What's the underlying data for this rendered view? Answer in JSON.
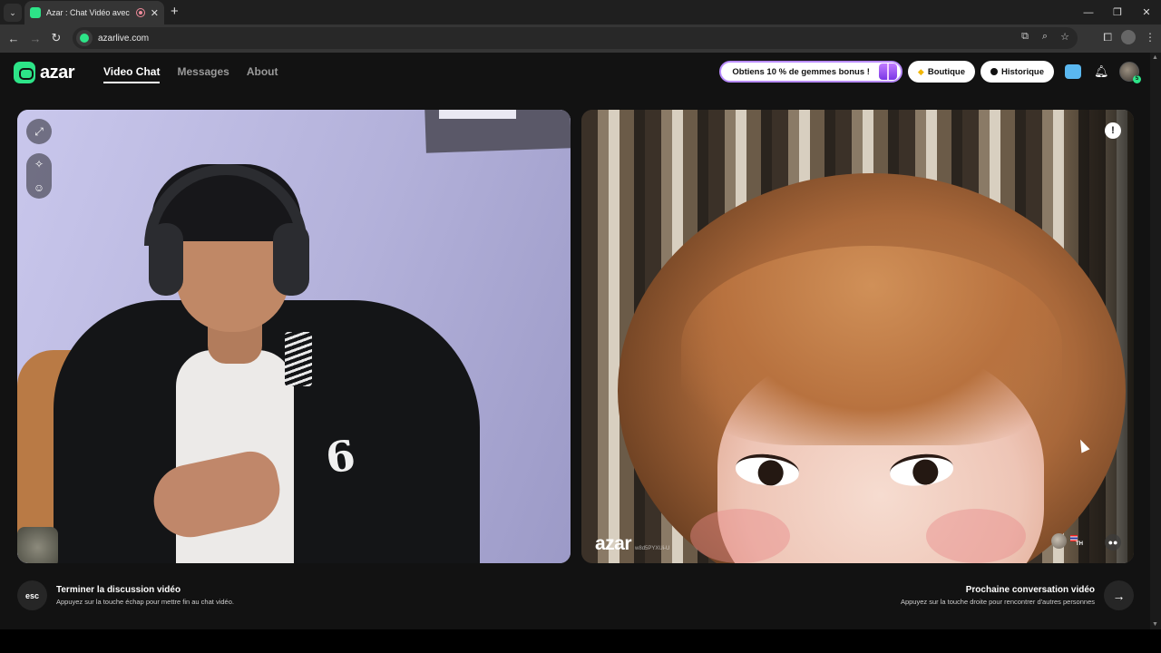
{
  "browser": {
    "tab_title": "Azar : Chat Vidéo avec de n",
    "tab_close": "✕",
    "new_tab": "+",
    "url": "azarlive.com",
    "back": "←",
    "forward": "→",
    "reload": "↻",
    "minimize": "—",
    "maximize": "❐",
    "close": "✕",
    "tab_menu": "⌄"
  },
  "header": {
    "logo_text": "azar",
    "nav": [
      {
        "label": "Video Chat",
        "active": true
      },
      {
        "label": "Messages",
        "active": false
      },
      {
        "label": "About",
        "active": false
      }
    ],
    "promo_label": "Obtiens 10 % de gemmes bonus !",
    "shop_label": "Boutique",
    "history_label": "Historique",
    "avatar_badge": "5"
  },
  "partner": {
    "watermark": "azar",
    "user_id": "w8d5PYXUi-U",
    "country": "TH",
    "report": "!"
  },
  "footer": {
    "esc_key": "esc",
    "end_title": "Terminer la discussion vidéo",
    "end_sub": "Appuyez sur la touche échap pour mettre fin au chat vidéo.",
    "next_title": "Prochaine conversation vidéo",
    "next_sub": "Appuyez sur la touche droite pour rencontrer d'autres personnes",
    "next_arrow": "→"
  },
  "colors": {
    "brand": "#2de488",
    "background": "#121212"
  },
  "icons": [
    "expand-icon",
    "magic-wand-icon",
    "face-filter-icon",
    "report-icon",
    "message-icon",
    "gift-icon",
    "gem-icon",
    "clock-icon",
    "bell-icon",
    "chat-bubble-icon"
  ]
}
